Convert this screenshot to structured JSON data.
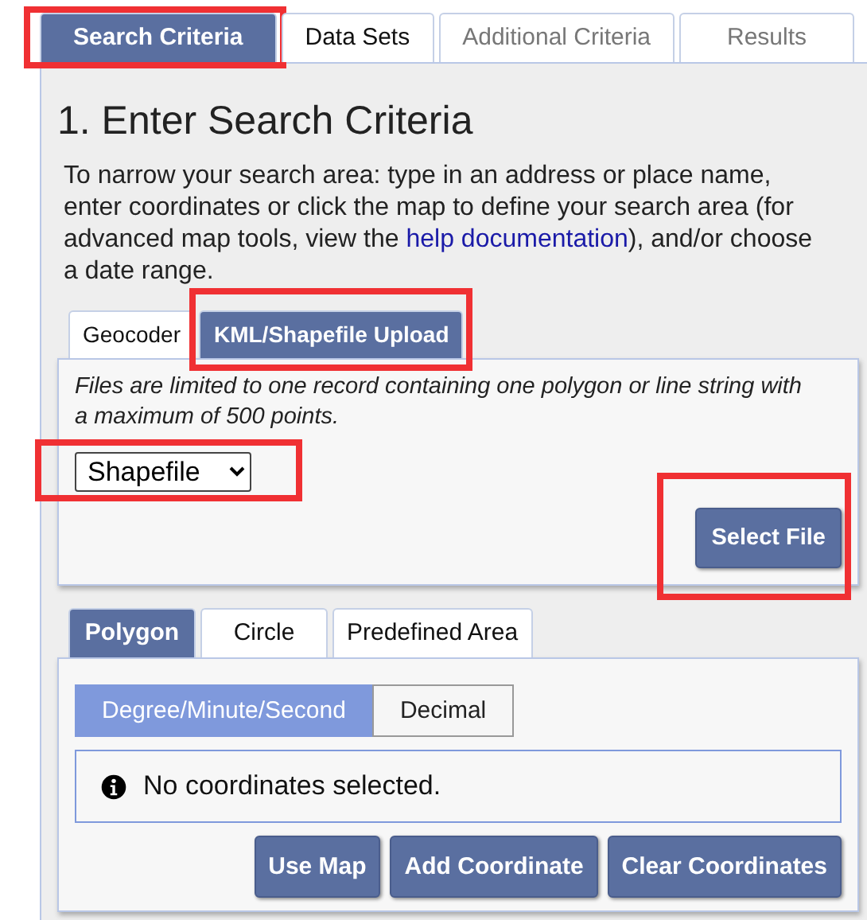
{
  "main_tabs": [
    {
      "label": "Search Criteria",
      "selected": true,
      "disabled": false,
      "highlighted": true
    },
    {
      "label": "Data Sets",
      "selected": false,
      "disabled": false,
      "highlighted": false
    },
    {
      "label": "Additional Criteria",
      "selected": false,
      "disabled": true,
      "highlighted": false
    },
    {
      "label": "Results",
      "selected": false,
      "disabled": true,
      "highlighted": false
    }
  ],
  "heading": "1. Enter Search Criteria",
  "intro": {
    "before": "To narrow your search area: type in an address or place name, enter coordinates or click the map to define your search area (for advanced map tools, view the ",
    "link": "help documentation",
    "after": "), and/or choose a date range."
  },
  "location_tabs": [
    {
      "label": "Geocoder",
      "selected": false,
      "highlighted": false
    },
    {
      "label": "KML/Shapefile Upload",
      "selected": true,
      "highlighted": true
    }
  ],
  "upload": {
    "note": "Files are limited to one record containing one polygon or line string with a maximum of 500 points.",
    "file_type": {
      "value": "Shapefile",
      "highlighted": true
    },
    "select_button": {
      "label": "Select File",
      "highlighted": true
    }
  },
  "area_tabs": [
    {
      "label": "Polygon",
      "selected": true
    },
    {
      "label": "Circle",
      "selected": false
    },
    {
      "label": "Predefined Area",
      "selected": false
    }
  ],
  "coordinate_formats": [
    {
      "label": "Degree/Minute/Second",
      "selected": true
    },
    {
      "label": "Decimal",
      "selected": false
    }
  ],
  "info_message": "No coordinates selected.",
  "action_buttons": [
    "Use Map",
    "Add Coordinate",
    "Clear Coordinates"
  ]
}
